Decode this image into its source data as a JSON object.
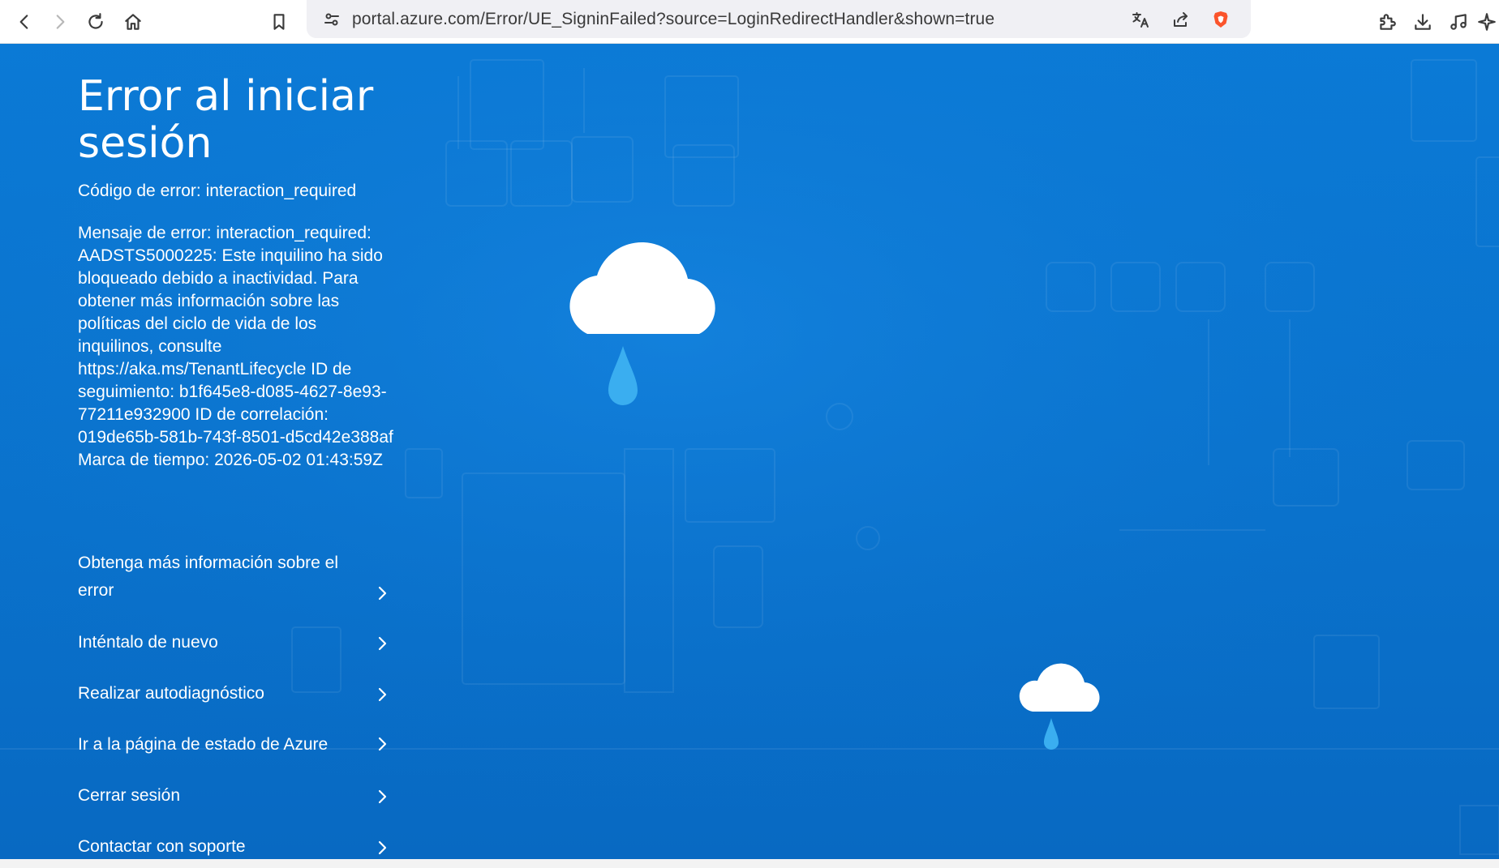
{
  "browser": {
    "url": "portal.azure.com/Error/UE_SigninFailed?source=LoginRedirectHandler&shown=true",
    "icons": [
      "back-icon",
      "forward-icon",
      "reload-icon",
      "home-icon",
      "bookmark-icon",
      "site-settings-icon",
      "translate-icon",
      "share-icon",
      "brave-shield-icon",
      "extensions-icon",
      "downloads-icon",
      "media-icon",
      "leo-icon"
    ]
  },
  "error": {
    "title": "Error al iniciar sesión",
    "code": "Código de error: interaction_required",
    "message": "Mensaje de error: interaction_required: AADSTS5000225: Este inquilino ha sido bloqueado debido a inactividad. Para obtener más información sobre las políticas del ciclo de vida de los inquilinos, consulte https://aka.ms/TenantLifecycle ID de seguimiento: b1f645e8-d085-4627-8e93-77211e932900 ID de correlación: 019de65b-581b-743f-8501-d5cd42e388af Marca de tiempo: 2026-05-02 01:43:59Z"
  },
  "links": [
    {
      "label": "Obtenga más información sobre el error"
    },
    {
      "label": "Inténtalo de nuevo"
    },
    {
      "label": "Realizar autodiagnóstico"
    },
    {
      "label": "Ir a la página de estado de Azure"
    },
    {
      "label": "Cerrar sesión"
    },
    {
      "label": "Contactar con soporte"
    }
  ],
  "colors": {
    "background": "#0a75d0",
    "drop": "#3aaef0",
    "cloud": "#ffffff"
  }
}
